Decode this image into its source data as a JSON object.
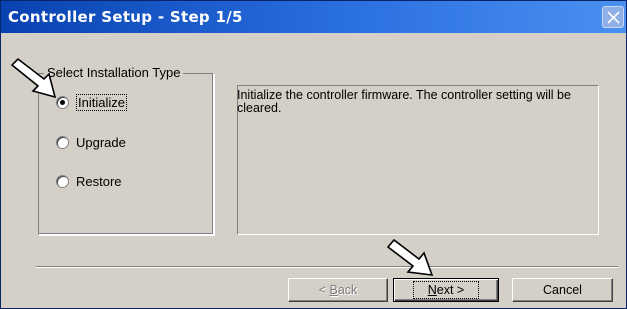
{
  "window": {
    "title": "Controller Setup - Step 1/5",
    "close_icon": "close-icon"
  },
  "group": {
    "title": "Select Installation Type",
    "options": [
      {
        "label": "Initialize",
        "selected": true
      },
      {
        "label": "Upgrade",
        "selected": false
      },
      {
        "label": "Restore",
        "selected": false
      }
    ]
  },
  "description": "Initialize the controller firmware. The controller setting will be cleared.",
  "buttons": {
    "back": {
      "mnemonic": "B",
      "label": "< Back",
      "enabled": false
    },
    "next": {
      "mnemonic": "N",
      "label": "Next >",
      "enabled": true
    },
    "cancel": {
      "label": "Cancel",
      "enabled": true
    }
  },
  "annotations": [
    "pointer-arrow-icon",
    "pointer-arrow-icon"
  ],
  "colors": {
    "titlebar_start": "#0842b0",
    "titlebar_end": "#4a90f0",
    "dialog_face": "#d4d0c8"
  }
}
